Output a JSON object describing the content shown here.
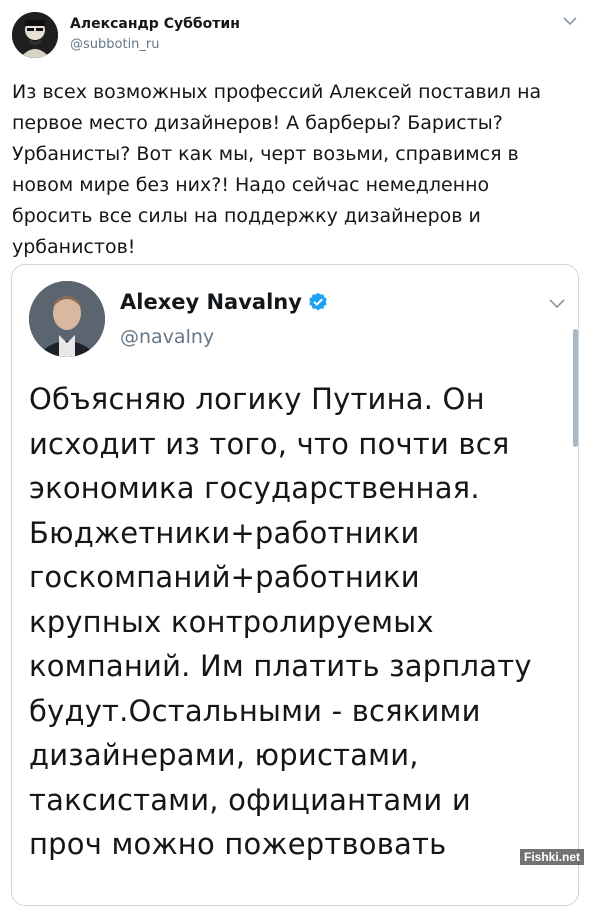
{
  "tweet": {
    "author": {
      "name": "Александр Субботин",
      "handle": "@subbotin_ru"
    },
    "text": "Из всех возможных профессий Алексей поставил на\nпервое место дизайнеров! А барберы? Баристы?\nУрбанисты? Вот как мы, черт возьми, справимся в\nновом мире без них?! Надо сейчас немедленно\nбросить все силы на поддержку дизайнеров и\nурбанистов!"
  },
  "quoted_tweet": {
    "author": {
      "name": "Alexey Navalny",
      "handle": "@navalny",
      "verified": true
    },
    "text": "Объясняю логику Путина. Он\nисходит из того, что почти вся\nэкономика государственная.\nБюджетники+работники\nгоскомпаний+работники\nкрупных контролируемых\nкомпаний. Им платить зарплату\nбудут.Остальными - всякими\nдизайнерами, юристами,\nтаксистами, официантами и\nпроч можно пожертвовать"
  },
  "watermark": "Fishki.net",
  "colors": {
    "text": "#14171a",
    "secondary": "#657786",
    "verified": "#1da1f2",
    "border": "#ccd6dd"
  },
  "icons": [
    "avatar",
    "chevron-down-icon",
    "verified-badge-icon"
  ]
}
